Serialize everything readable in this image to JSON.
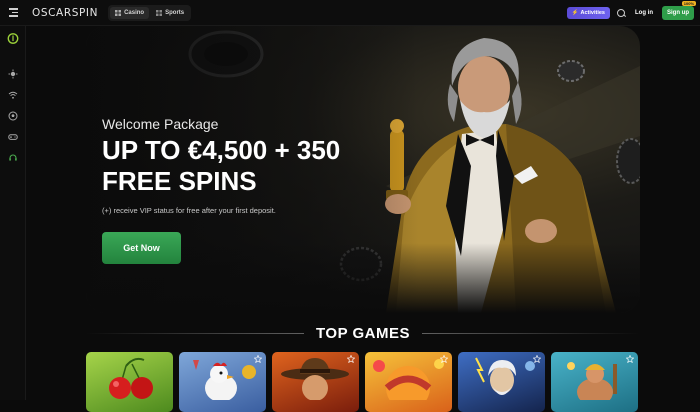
{
  "header": {
    "logo": "OSCARSPIN",
    "tabs": [
      {
        "label": "Casino",
        "icon": "casino-icon",
        "active": true
      },
      {
        "label": "Sports",
        "icon": "sports-icon",
        "active": false
      }
    ],
    "activities_label": "Activities",
    "login_label": "Log in",
    "signup_label": "Sign up",
    "signup_badge": "100%",
    "accent_purple": "#6e62ef",
    "accent_green": "#2f9e4a"
  },
  "sidebar": {
    "items": [
      {
        "icon": "oscar-logo-icon"
      },
      {
        "icon": "sun-icon"
      },
      {
        "icon": "wifi-icon"
      },
      {
        "icon": "football-icon"
      },
      {
        "icon": "gamepad-icon"
      },
      {
        "icon": "support-icon"
      }
    ]
  },
  "hero": {
    "subtitle": "Welcome Package",
    "headline": "UP TO €4,500 + 350 FREE SPINS",
    "note": "(+) receive VIP status for free after your first deposit.",
    "cta_label": "Get Now"
  },
  "top_games": {
    "title": "TOP GAMES",
    "games": [
      {
        "theme": "cherries"
      },
      {
        "theme": "chicken"
      },
      {
        "theme": "adventurer"
      },
      {
        "theme": "fruit-slot"
      },
      {
        "theme": "zeus"
      },
      {
        "theme": "hercules"
      }
    ]
  }
}
